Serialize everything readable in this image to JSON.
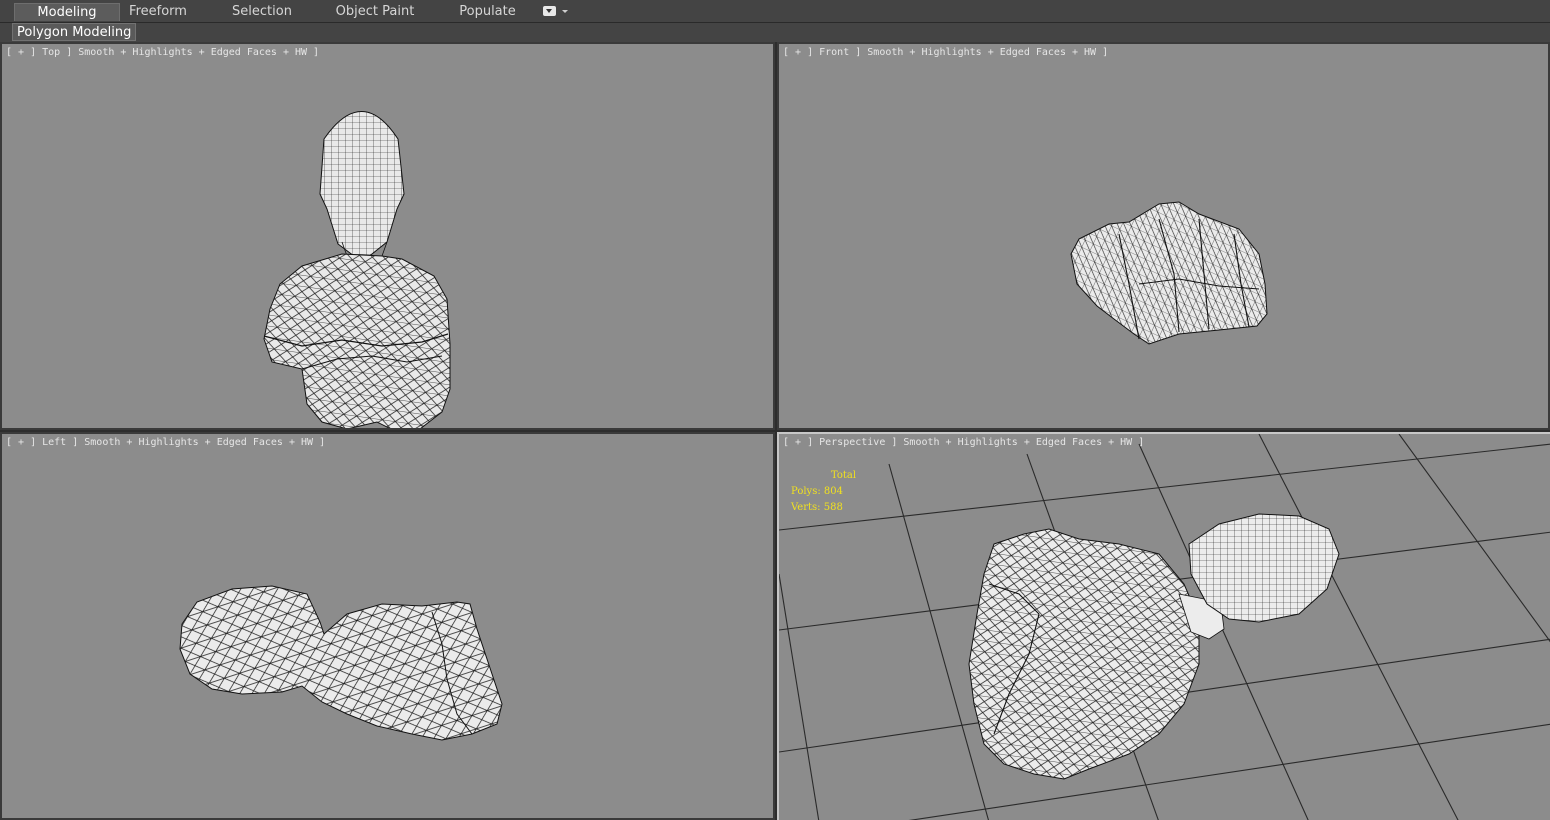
{
  "ribbon": {
    "tabs": [
      {
        "label": "Modeling",
        "active": true
      },
      {
        "label": "Freeform"
      },
      {
        "label": "Selection"
      },
      {
        "label": "Object Paint"
      },
      {
        "label": "Populate"
      }
    ],
    "sub_tab": "Polygon Modeling"
  },
  "viewports": {
    "top": {
      "label": "[ + ] Top ] Smooth + Highlights + Edged Faces + HW ]"
    },
    "front": {
      "label": "[ + ] Front ] Smooth + Highlights + Edged Faces + HW ]"
    },
    "left": {
      "label": "[ + ] Left ] Smooth + Highlights + Edged Faces + HW ]"
    },
    "perspective": {
      "label": "[ + ] Perspective ] Smooth + Highlights + Edged Faces + HW ]"
    }
  },
  "stats": {
    "title": "Total",
    "polys_label": "Polys:",
    "polys_value": "804",
    "verts_label": "Verts:",
    "verts_value": "588"
  },
  "colors": {
    "viewport_bg": "#8c8c8c",
    "stats_text": "#f0e020",
    "active_border": "#c7c7c7"
  }
}
